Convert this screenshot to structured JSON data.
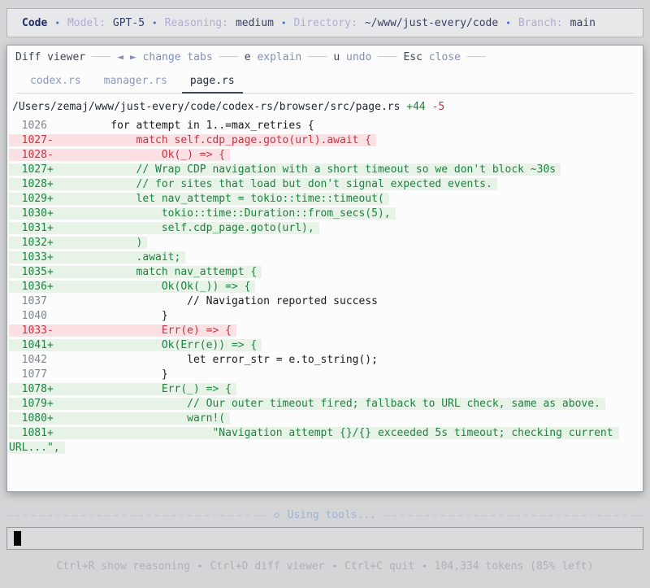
{
  "colors": {
    "addition_green": "#1a7f37",
    "deletion_red": "#cb2f3c",
    "accent_blue": "#5367d6",
    "added_bg": "#e6f3e6",
    "removed_bg": "#fce1e4"
  },
  "header": {
    "app": "Code",
    "items": [
      {
        "label": "Model:",
        "value": "GPT-5"
      },
      {
        "label": "Reasoning:",
        "value": "medium"
      },
      {
        "label": "Directory:",
        "value": "~/www/just-every/code"
      },
      {
        "label": "Branch:",
        "value": "main"
      }
    ]
  },
  "diff_viewer": {
    "title": "Diff viewer",
    "separator": "───",
    "controls": [
      {
        "key": "◄ ►",
        "label": "change tabs",
        "accent": true
      },
      {
        "key": "e",
        "label": "explain",
        "accent": false
      },
      {
        "key": "u",
        "label": "undo",
        "accent": false
      },
      {
        "key": "Esc",
        "label": "close",
        "accent": false
      }
    ],
    "tabs": [
      {
        "label": "codex.rs",
        "active": false
      },
      {
        "label": "manager.rs",
        "active": false
      },
      {
        "label": "page.rs",
        "active": true
      }
    ],
    "file_path": "/Users/zemaj/www/just-every/code/codex-rs/browser/src/page.rs",
    "additions": "+44",
    "deletions": "-5",
    "lines": [
      {
        "num": "1026",
        "sign": "",
        "type": "context",
        "code": "        for attempt in 1..=max_retries {"
      },
      {
        "num": "1027",
        "sign": "-",
        "type": "del",
        "code": "            match self.cdp_page.goto(url).await {"
      },
      {
        "num": "1028",
        "sign": "-",
        "type": "del",
        "code": "                Ok(_) => {"
      },
      {
        "num": "1027",
        "sign": "+",
        "type": "add",
        "code": "            // Wrap CDP navigation with a short timeout so we don't block ~30s"
      },
      {
        "num": "1028",
        "sign": "+",
        "type": "add",
        "code": "            // for sites that load but don't signal expected events."
      },
      {
        "num": "1029",
        "sign": "+",
        "type": "add",
        "code": "            let nav_attempt = tokio::time::timeout("
      },
      {
        "num": "1030",
        "sign": "+",
        "type": "add",
        "code": "                tokio::time::Duration::from_secs(5),"
      },
      {
        "num": "1031",
        "sign": "+",
        "type": "add",
        "code": "                self.cdp_page.goto(url),"
      },
      {
        "num": "1032",
        "sign": "+",
        "type": "add",
        "code": "            )"
      },
      {
        "num": "1033",
        "sign": "+",
        "type": "add",
        "code": "            .await;"
      },
      {
        "num": "1035",
        "sign": "+",
        "type": "add",
        "code": "            match nav_attempt {"
      },
      {
        "num": "1036",
        "sign": "+",
        "type": "add",
        "code": "                Ok(Ok(_)) => {"
      },
      {
        "num": "1037",
        "sign": "",
        "type": "context",
        "code": "                    // Navigation reported success"
      },
      {
        "num": "1040",
        "sign": "",
        "type": "context",
        "code": "                }"
      },
      {
        "num": "1033",
        "sign": "-",
        "type": "del",
        "code": "                Err(e) => {"
      },
      {
        "num": "1041",
        "sign": "+",
        "type": "add",
        "code": "                Ok(Err(e)) => {"
      },
      {
        "num": "1042",
        "sign": "",
        "type": "context",
        "code": "                    let error_str = e.to_string();"
      },
      {
        "num": "1077",
        "sign": "",
        "type": "context",
        "code": "                }"
      },
      {
        "num": "1078",
        "sign": "+",
        "type": "add",
        "code": "                Err(_) => {"
      },
      {
        "num": "1079",
        "sign": "+",
        "type": "add",
        "code": "                    // Our outer timeout fired; fallback to URL check, same as above."
      },
      {
        "num": "1080",
        "sign": "+",
        "type": "add",
        "code": "                    warn!("
      },
      {
        "num": "1081",
        "sign": "+",
        "type": "add",
        "code": "                        \"Navigation attempt {}/{} exceeded 5s timeout; checking current URL...\","
      }
    ]
  },
  "status_line": {
    "icon": "◇",
    "text": "Using tools..."
  },
  "input": {
    "value": "",
    "cursor": "block"
  },
  "footer": {
    "items": [
      {
        "key": "Ctrl+R",
        "label": "show reasoning"
      },
      {
        "key": "Ctrl+D",
        "label": "diff viewer"
      },
      {
        "key": "Ctrl+C",
        "label": "quit"
      }
    ],
    "tokens": "104,334 tokens (85% left)"
  }
}
